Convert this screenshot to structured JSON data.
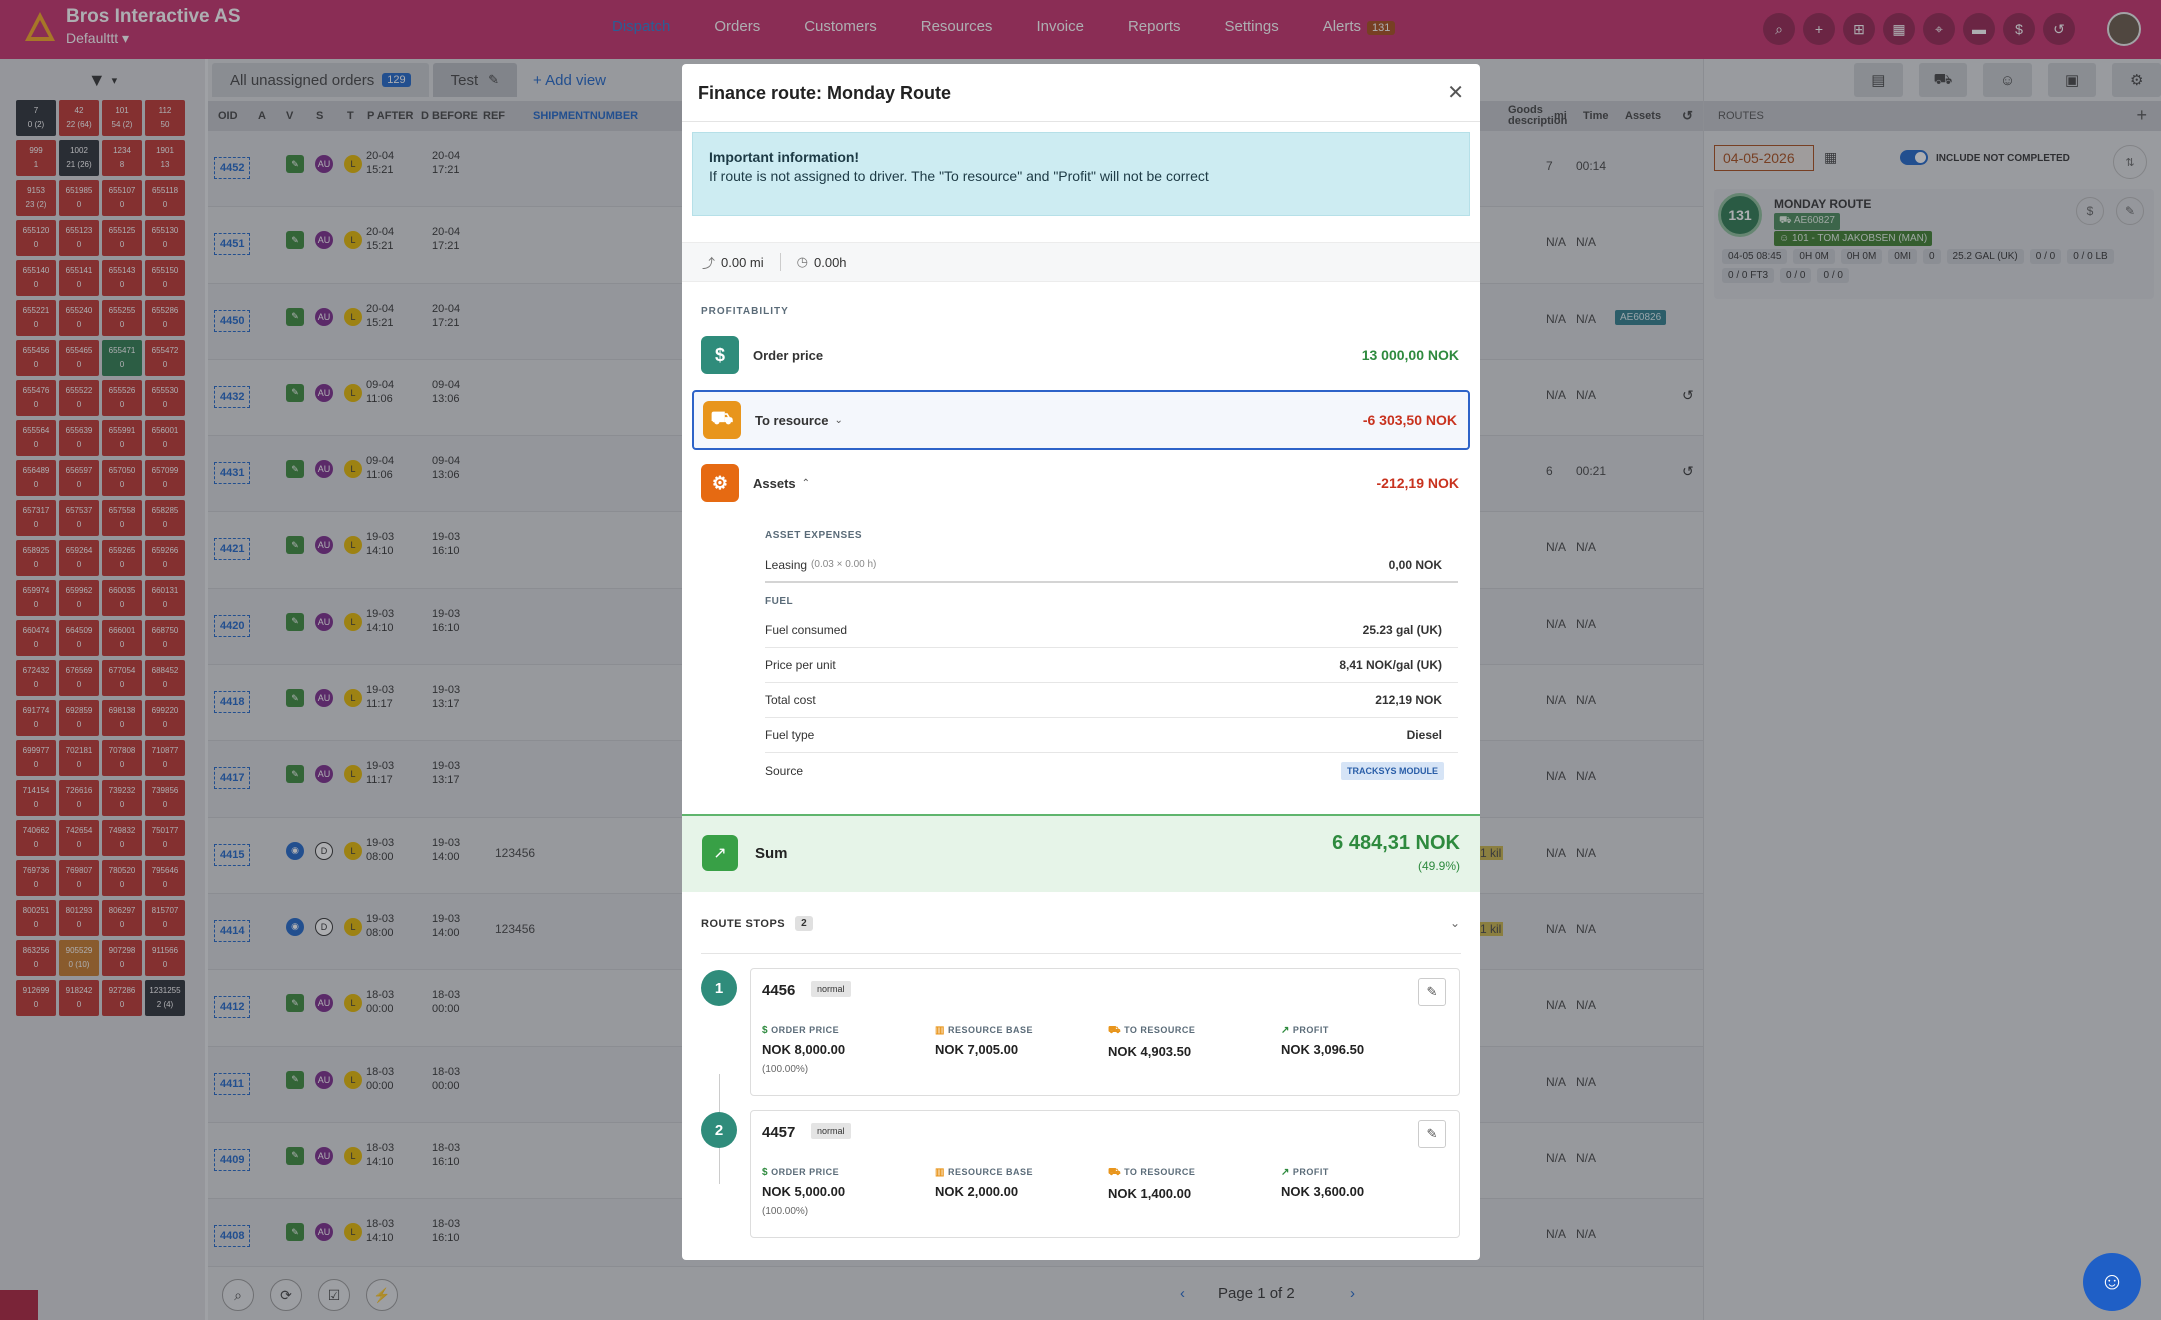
{
  "app": {
    "company": "Bros Interactive AS",
    "profile": "Defaulttt",
    "nav": [
      "Dispatch",
      "Orders",
      "Customers",
      "Resources",
      "Invoice",
      "Reports",
      "Settings",
      "Alerts"
    ],
    "alerts_count": "131"
  },
  "left": {
    "cells": [
      [
        "7",
        "0 (2)"
      ],
      [
        "42",
        "22 (64)"
      ],
      [
        "101",
        "54 (2)"
      ],
      [
        "112",
        "50"
      ],
      [
        "999",
        "1"
      ],
      [
        "1002",
        "21 (26)"
      ],
      [
        "1234",
        "8"
      ],
      [
        "1901",
        "13"
      ],
      [
        "9153",
        "23 (2)"
      ],
      [
        "651985",
        "0"
      ],
      [
        "655107",
        "0"
      ],
      [
        "655118",
        "0"
      ],
      [
        "655120",
        "0"
      ],
      [
        "655123",
        "0"
      ],
      [
        "655125",
        "0"
      ],
      [
        "655130",
        "0"
      ],
      [
        "655140",
        "0"
      ],
      [
        "655141",
        "0"
      ],
      [
        "655143",
        "0"
      ],
      [
        "655150",
        "0"
      ],
      [
        "655221",
        "0"
      ],
      [
        "655240",
        "0"
      ],
      [
        "655255",
        "0"
      ],
      [
        "655286",
        "0"
      ],
      [
        "655456",
        "0"
      ],
      [
        "655465",
        "0"
      ],
      [
        "655471",
        "0"
      ],
      [
        "655472",
        "0"
      ],
      [
        "655476",
        "0"
      ],
      [
        "655522",
        "0"
      ],
      [
        "655526",
        "0"
      ],
      [
        "655530",
        "0"
      ],
      [
        "655564",
        "0"
      ],
      [
        "655639",
        "0"
      ],
      [
        "655991",
        "0"
      ],
      [
        "656001",
        "0"
      ],
      [
        "656489",
        "0"
      ],
      [
        "656597",
        "0"
      ],
      [
        "657050",
        "0"
      ],
      [
        "657099",
        "0"
      ],
      [
        "657317",
        "0"
      ],
      [
        "657537",
        "0"
      ],
      [
        "657558",
        "0"
      ],
      [
        "658285",
        "0"
      ],
      [
        "658925",
        "0"
      ],
      [
        "659264",
        "0"
      ],
      [
        "659265",
        "0"
      ],
      [
        "659266",
        "0"
      ],
      [
        "659974",
        "0"
      ],
      [
        "659962",
        "0"
      ],
      [
        "660035",
        "0"
      ],
      [
        "660131",
        "0"
      ],
      [
        "660474",
        "0"
      ],
      [
        "664509",
        "0"
      ],
      [
        "666001",
        "0"
      ],
      [
        "668750",
        "0"
      ],
      [
        "672432",
        "0"
      ],
      [
        "676569",
        "0"
      ],
      [
        "677054",
        "0"
      ],
      [
        "688452",
        "0"
      ],
      [
        "691774",
        "0"
      ],
      [
        "692859",
        "0"
      ],
      [
        "698138",
        "0"
      ],
      [
        "699220",
        "0"
      ],
      [
        "699977",
        "0"
      ],
      [
        "702181",
        "0"
      ],
      [
        "707808",
        "0"
      ],
      [
        "710877",
        "0"
      ],
      [
        "714154",
        "0"
      ],
      [
        "726616",
        "0"
      ],
      [
        "739232",
        "0"
      ],
      [
        "739856",
        "0"
      ],
      [
        "740662",
        "0"
      ],
      [
        "742654",
        "0"
      ],
      [
        "749832",
        "0"
      ],
      [
        "750177",
        "0"
      ],
      [
        "769736",
        "0"
      ],
      [
        "769807",
        "0"
      ],
      [
        "780520",
        "0"
      ],
      [
        "795646",
        "0"
      ],
      [
        "800251",
        "0"
      ],
      [
        "801293",
        "0"
      ],
      [
        "806297",
        "0"
      ],
      [
        "815707",
        "0"
      ],
      [
        "863256",
        "0"
      ],
      [
        "905529",
        "0 (10)"
      ],
      [
        "907298",
        "0"
      ],
      [
        "911566",
        "0"
      ],
      [
        "912699",
        "0"
      ],
      [
        "918242",
        "0"
      ],
      [
        "927286",
        "0"
      ],
      [
        "1231255",
        "2 (4)"
      ]
    ]
  },
  "main": {
    "tabs": [
      {
        "label": "All unassigned orders",
        "count": "129"
      },
      {
        "label": "Test"
      }
    ],
    "add_view": "+ Add view",
    "headers": [
      "OID",
      "A",
      "V",
      "S",
      "T",
      "P AFTER",
      "D BEFORE",
      "REF",
      "SHIPMENTNUMBER",
      "Goods description",
      "mi",
      "Time",
      "Assets"
    ],
    "rows": [
      {
        "oid": "4452",
        "pa": [
          "20-04",
          "15:21"
        ],
        "db": [
          "20-04",
          "17:21"
        ],
        "ref": "",
        "mi": "7",
        "time": "00:14",
        "type": "a"
      },
      {
        "oid": "4451",
        "pa": [
          "20-04",
          "15:21"
        ],
        "db": [
          "20-04",
          "17:21"
        ],
        "ref": "",
        "mi": "N/A",
        "time": "N/A",
        "type": "a"
      },
      {
        "oid": "4450",
        "pa": [
          "20-04",
          "15:21"
        ],
        "db": [
          "20-04",
          "17:21"
        ],
        "ref": "",
        "mi": "N/A",
        "time": "N/A",
        "type": "a",
        "asset": "AE60826"
      },
      {
        "oid": "4432",
        "pa": [
          "09-04",
          "11:06"
        ],
        "db": [
          "09-04",
          "13:06"
        ],
        "ref": "",
        "mi": "N/A",
        "time": "N/A",
        "type": "a",
        "undo": true
      },
      {
        "oid": "4431",
        "pa": [
          "09-04",
          "11:06"
        ],
        "db": [
          "09-04",
          "13:06"
        ],
        "ref": "",
        "mi": "6",
        "time": "00:21",
        "type": "a",
        "undo": true
      },
      {
        "oid": "4421",
        "pa": [
          "19-03",
          "14:10"
        ],
        "db": [
          "19-03",
          "16:10"
        ],
        "ref": "",
        "mi": "N/A",
        "time": "N/A",
        "type": "a"
      },
      {
        "oid": "4420",
        "pa": [
          "19-03",
          "14:10"
        ],
        "db": [
          "19-03",
          "16:10"
        ],
        "ref": "",
        "mi": "N/A",
        "time": "N/A",
        "type": "a"
      },
      {
        "oid": "4418",
        "pa": [
          "19-03",
          "11:17"
        ],
        "db": [
          "19-03",
          "13:17"
        ],
        "ref": "",
        "mi": "N/A",
        "time": "N/A",
        "type": "a"
      },
      {
        "oid": "4417",
        "pa": [
          "19-03",
          "11:17"
        ],
        "db": [
          "19-03",
          "13:17"
        ],
        "ref": "",
        "mi": "N/A",
        "time": "N/A",
        "type": "a"
      },
      {
        "oid": "4415",
        "pa": [
          "19-03",
          "08:00"
        ],
        "db": [
          "19-03",
          "14:00"
        ],
        "ref": "123456",
        "mi": "N/A",
        "time": "N/A",
        "type": "b",
        "goods": "1 kil"
      },
      {
        "oid": "4414",
        "pa": [
          "19-03",
          "08:00"
        ],
        "db": [
          "19-03",
          "14:00"
        ],
        "ref": "123456",
        "mi": "N/A",
        "time": "N/A",
        "type": "b",
        "goods": "1 kil"
      },
      {
        "oid": "4412",
        "pa": [
          "18-03",
          "00:00"
        ],
        "db": [
          "18-03",
          "00:00"
        ],
        "ref": "",
        "mi": "N/A",
        "time": "N/A",
        "type": "a"
      },
      {
        "oid": "4411",
        "pa": [
          "18-03",
          "00:00"
        ],
        "db": [
          "18-03",
          "00:00"
        ],
        "ref": "",
        "mi": "N/A",
        "time": "N/A",
        "type": "a"
      },
      {
        "oid": "4409",
        "pa": [
          "18-03",
          "14:10"
        ],
        "db": [
          "18-03",
          "16:10"
        ],
        "ref": "",
        "mi": "N/A",
        "time": "N/A",
        "type": "a"
      },
      {
        "oid": "4408",
        "pa": [
          "18-03",
          "14:10"
        ],
        "db": [
          "18-03",
          "16:10"
        ],
        "ref": "",
        "mi": "N/A",
        "time": "N/A",
        "type": "a"
      }
    ],
    "pager": "Page 1 of 2"
  },
  "routes": {
    "header": "ROUTES",
    "date": "04-05-2026",
    "include_label": "INCLUDE NOT COMPLETED",
    "route": {
      "number": "131",
      "name": "MONDAY ROUTE",
      "vehicle": "AE60827",
      "driver": "101 - TOM JAKOBSEN (MAN)",
      "stats": [
        "04-05 08:45",
        "0H 0M",
        "0H 0M",
        "0MI",
        "0",
        "25.2 GAL (UK)",
        "0 / 0",
        "0 / 0 LB",
        "0 / 0 FT3",
        "0 / 0",
        "0 / 0"
      ]
    }
  },
  "modal": {
    "title": "Finance route: Monday Route",
    "info_title": "Important information!",
    "info_text": "If route is not assigned to driver. The \"To resource\" and \"Profit\" will not be correct",
    "distance": "0.00 mi",
    "duration": "0.00h",
    "profitability_label": "PROFITABILITY",
    "order_price": {
      "label": "Order price",
      "value": "13 000,00 NOK"
    },
    "to_resource": {
      "label": "To resource",
      "value": "-6 303,50 NOK"
    },
    "assets": {
      "label": "Assets",
      "value": "-212,19 NOK"
    },
    "asset_expenses_label": "ASSET EXPENSES",
    "leasing": {
      "label": "Leasing",
      "detail": "(0.03 × 0.00 h)",
      "value": "0,00 NOK"
    },
    "fuel_label": "FUEL",
    "fuel_rows": [
      {
        "label": "Fuel consumed",
        "value": "25.23 gal (UK)"
      },
      {
        "label": "Price per unit",
        "value": "8,41 NOK/gal (UK)"
      },
      {
        "label": "Total cost",
        "value": "212,19 NOK"
      },
      {
        "label": "Fuel type",
        "value": "Diesel"
      }
    ],
    "source": {
      "label": "Source",
      "value": "TRACKSYS MODULE"
    },
    "sum": {
      "label": "Sum",
      "value": "6 484,31 NOK",
      "pct": "(49.9%)"
    },
    "stops_label": "ROUTE STOPS",
    "stops_count": "2",
    "stops": [
      {
        "num": "1",
        "id": "4456",
        "tag": "normal",
        "order_price": "NOK 8,000.00",
        "order_pct": "(100.00%)",
        "resource_base": "NOK 7,005.00",
        "to_resource": "NOK 4,903.50",
        "profit": "NOK 3,096.50"
      },
      {
        "num": "2",
        "id": "4457",
        "tag": "normal",
        "order_price": "NOK 5,000.00",
        "order_pct": "(100.00%)",
        "resource_base": "NOK 2,000.00",
        "to_resource": "NOK 1,400.00",
        "profit": "NOK 3,600.00"
      }
    ],
    "col_labels": {
      "order_price": "ORDER PRICE",
      "resource_base": "RESOURCE BASE",
      "to_resource": "TO RESOURCE",
      "profit": "PROFIT"
    }
  }
}
